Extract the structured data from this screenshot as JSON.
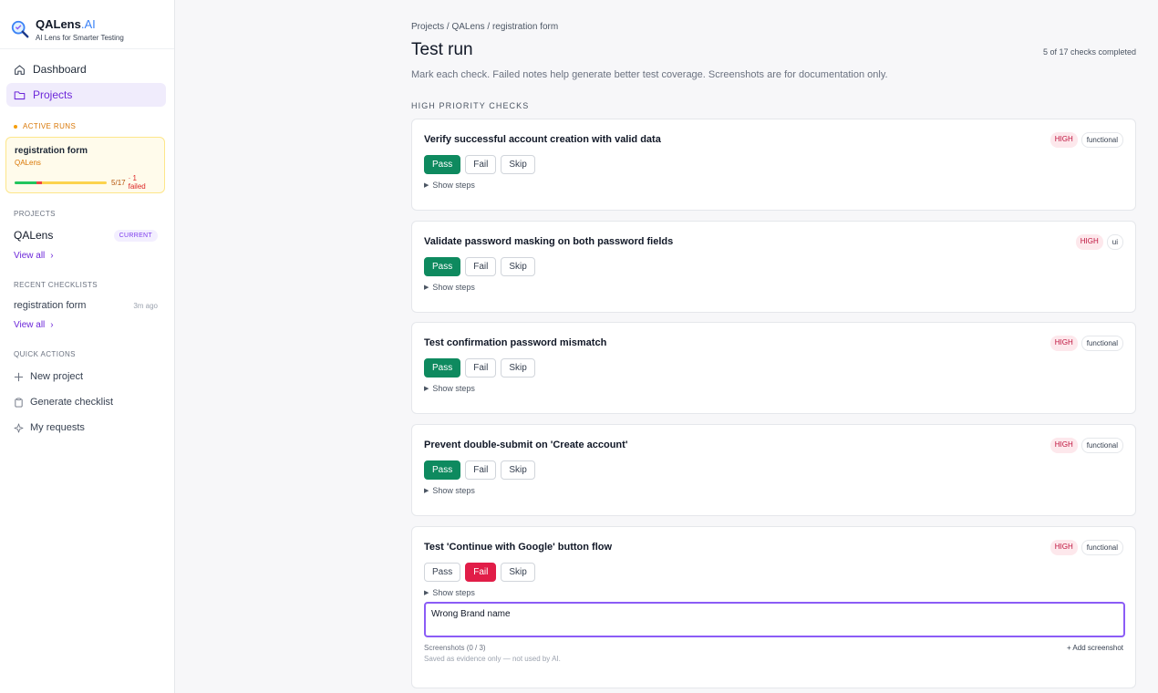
{
  "brand": {
    "name": "QALens",
    "ai": ".AI",
    "tagline": "AI Lens for Smarter Testing"
  },
  "nav": [
    {
      "label": "Dashboard",
      "icon": "home-icon",
      "active": false
    },
    {
      "label": "Projects",
      "icon": "folder-icon",
      "active": true
    }
  ],
  "active_runs": {
    "label": "ACTIVE RUNS",
    "run": {
      "title": "registration form",
      "project": "QALens",
      "count": "5/17",
      "failed": "· 1 failed",
      "pass_fraction": 0.235,
      "fail_fraction": 0.059
    }
  },
  "projects": {
    "label": "PROJECTS",
    "name": "QALens",
    "badge": "CURRENT",
    "view_all": "View all"
  },
  "recent": {
    "label": "RECENT CHECKLISTS",
    "name": "registration form",
    "time": "3m ago",
    "view_all": "View all"
  },
  "quick": {
    "label": "QUICK ACTIONS",
    "items": [
      {
        "label": "New project",
        "icon": "plus-icon"
      },
      {
        "label": "Generate checklist",
        "icon": "clipboard-icon"
      },
      {
        "label": "My requests",
        "icon": "sparkle-icon"
      }
    ]
  },
  "main": {
    "breadcrumb": [
      "Projects",
      "QALens",
      "registration form"
    ],
    "breadcrumb_sep": " / ",
    "title": "Test run",
    "progress": "5 of 17 checks completed",
    "subtitle": "Mark each check. Failed notes help generate better test coverage. Screenshots are for documentation only.",
    "group": "HIGH PRIORITY CHECKS",
    "buttons": {
      "pass": "Pass",
      "fail": "Fail",
      "skip": "Skip"
    },
    "show_steps": "Show steps",
    "checks": [
      {
        "title": "Verify successful account creation with valid data",
        "priority": "HIGH",
        "type": "functional",
        "status": "pass"
      },
      {
        "title": "Validate password masking on both password fields",
        "priority": "HIGH",
        "type": "ui",
        "status": "pass"
      },
      {
        "title": "Test confirmation password mismatch",
        "priority": "HIGH",
        "type": "functional",
        "status": "pass"
      },
      {
        "title": "Prevent double-submit on 'Create account'",
        "priority": "HIGH",
        "type": "functional",
        "status": "pass"
      },
      {
        "title": "Test 'Continue with Google' button flow",
        "priority": "HIGH",
        "type": "functional",
        "status": "fail",
        "note": "Wrong Brand name"
      }
    ],
    "screenshots": {
      "label": "Screenshots (0 / 3)",
      "add": "+ Add screenshot",
      "hint": "Saved as evidence only — not used by AI."
    }
  },
  "colors": {
    "accent": "#6d28d9",
    "pass": "#0e8a5f",
    "fail": "#e11d48",
    "warning": "#f59e0b"
  }
}
